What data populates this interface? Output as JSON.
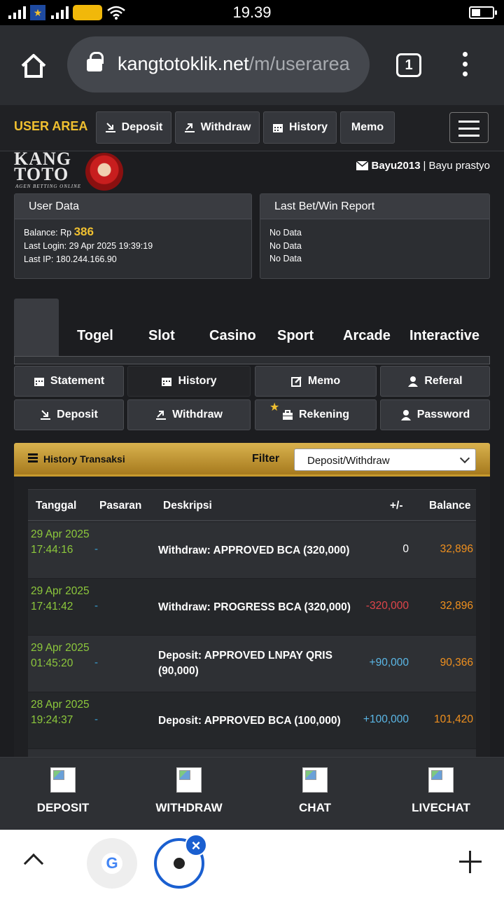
{
  "status": {
    "time": "19.39"
  },
  "browser": {
    "url_host": "kangtotoklik.net",
    "url_path": "/m/userarea",
    "tab_count": "1"
  },
  "nav": {
    "user_area": "USER AREA",
    "deposit": "Deposit",
    "withdraw": "Withdraw",
    "history": "History",
    "memo": "Memo"
  },
  "logo": {
    "line1": "KANG",
    "line2": "TOTO",
    "tagline": "AGEN BETTING ONLINE"
  },
  "user": {
    "username": "Bayu2013",
    "separator": "|",
    "fullname": "Bayu prastyo"
  },
  "user_data": {
    "title": "User Data",
    "balance_label": "Balance: Rp",
    "balance_value": "386",
    "last_login": "Last Login: 29 Apr 2025 19:39:19",
    "last_ip": "Last IP: 180.244.166.90"
  },
  "last_bet": {
    "title": "Last Bet/Win Report",
    "rows": [
      "No Data",
      "No Data",
      "No Data"
    ]
  },
  "game_tabs": [
    "Togel",
    "Slot",
    "Casino",
    "Sport",
    "Arcade",
    "Interactive"
  ],
  "menu": {
    "statement": "Statement",
    "history": "History",
    "memo": "Memo",
    "referal": "Referal",
    "deposit": "Deposit",
    "withdraw": "Withdraw",
    "rekening": "Rekening",
    "password": "Password"
  },
  "history": {
    "title": "History Transaksi",
    "filter_label": "Filter",
    "filter_value": "Deposit/Withdraw",
    "columns": [
      "Tanggal",
      "Pasaran",
      "Deskripsi",
      "+/-",
      "Balance"
    ],
    "rows": [
      {
        "date": "29 Apr 2025 17:44:16",
        "pasaran": "-",
        "desc": "Withdraw: APPROVED BCA (320,000)",
        "amount": "0",
        "balance": "32,896"
      },
      {
        "date": "29 Apr 2025 17:41:42",
        "pasaran": "-",
        "desc": "Withdraw: PROGRESS BCA (320,000)",
        "amount": "-320,000",
        "balance": "32,896"
      },
      {
        "date": "29 Apr 2025 01:45:20",
        "pasaran": "-",
        "desc": "Deposit: APPROVED LNPAY QRIS (90,000)",
        "amount": "+90,000",
        "balance": "90,366"
      },
      {
        "date": "28 Apr 2025 19:24:37",
        "pasaran": "-",
        "desc": "Deposit: APPROVED BCA (100,000)",
        "amount": "+100,000",
        "balance": "101,420"
      }
    ]
  },
  "float_nav": [
    "DEPOSIT",
    "WITHDRAW",
    "CHAT",
    "LIVECHAT"
  ],
  "colors": {
    "accent": "#f0c030",
    "positive": "#5bb7e6",
    "negative": "#e0454a",
    "neutral": "#ffffff",
    "date": "#8dc83c",
    "balance": "#f0901e"
  }
}
